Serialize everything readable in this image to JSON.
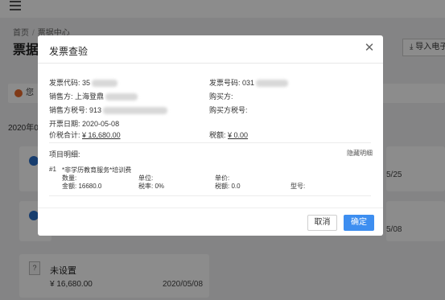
{
  "page": {
    "breadcrumb": [
      "首页",
      "票据中心"
    ],
    "title": "票据中",
    "import_button": "导入电子",
    "notice": "您",
    "date_group": "2020年05",
    "cards": {
      "r1_date": "5/25",
      "r2_date": "5/08",
      "bottom": {
        "name": "未设置",
        "amount": "¥ 16,680.00",
        "date": "2020/05/08",
        "icon": "?"
      }
    }
  },
  "modal": {
    "title": "发票查验",
    "fields": {
      "invoice_code_label": "发票代码:",
      "invoice_code_value": "35",
      "invoice_no_label": "发票号码:",
      "invoice_no_value": "031",
      "seller_label": "销售方:",
      "seller_value": "上海登鼎",
      "buyer_label": "购买方:",
      "buyer_value": "",
      "seller_tax_label": "销售方税号:",
      "seller_tax_value": "913",
      "buyer_tax_label": "购买方税号:",
      "buyer_tax_value": "",
      "issue_date_label": "开票日期:",
      "issue_date_value": "2020-05-08",
      "total_label": "价税合计:",
      "total_value": "¥ 16,680.00",
      "tax_label": "税额:",
      "tax_value": "¥ 0.00"
    },
    "items_title": "项目明细:",
    "collapse_label": "隐藏明细",
    "items": [
      {
        "index": "#1",
        "name": "*非学历教育服务*培训费",
        "qty_label": "数量:",
        "unit_label": "单位:",
        "price_label": "单价:",
        "amount_label": "金额: 16680.0",
        "rate_label": "税率: 0%",
        "tax_label": "税额: 0.0",
        "model_label": "型号:"
      }
    ],
    "cancel_label": "取消",
    "ok_label": "确定",
    "close_icon": "close-icon"
  },
  "colors": {
    "primary": "#3d8ef0",
    "overlay": "rgba(0,0,0,0.45)",
    "card_icon": "#2a6fc9"
  }
}
